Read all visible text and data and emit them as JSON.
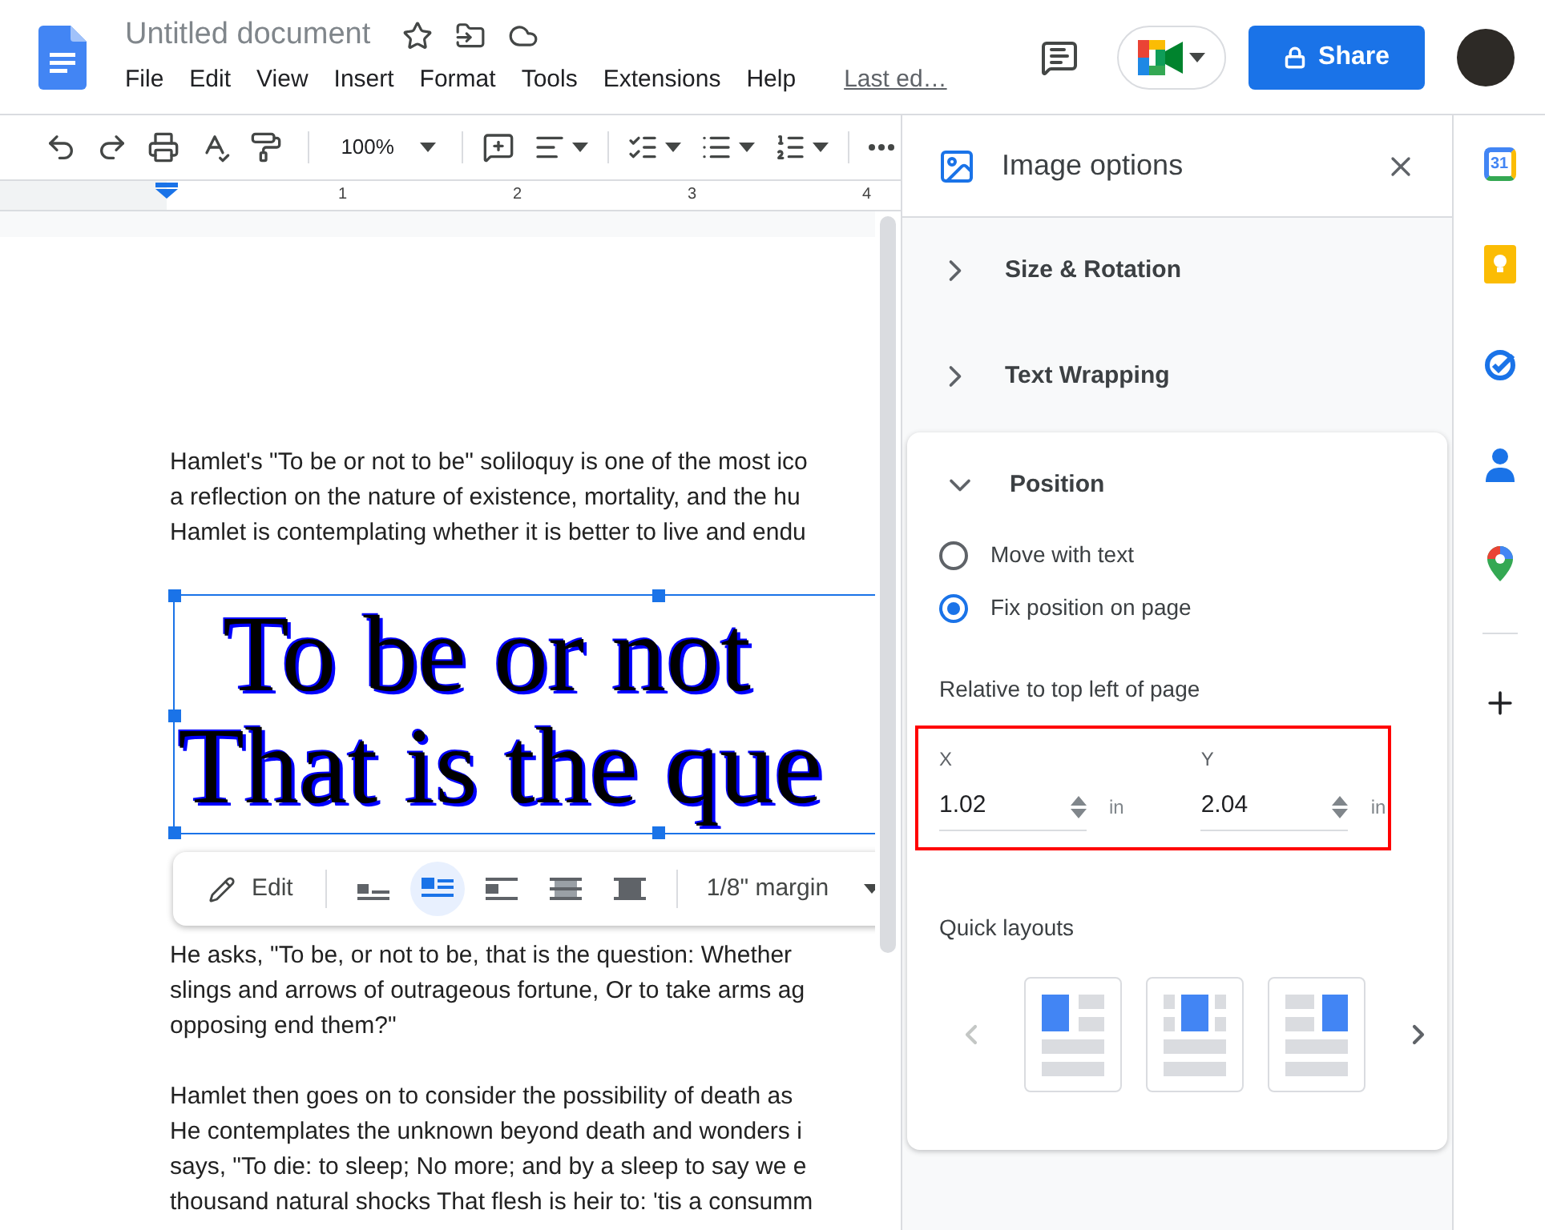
{
  "header": {
    "title": "Untitled document",
    "menus": [
      "File",
      "Edit",
      "View",
      "Insert",
      "Format",
      "Tools",
      "Extensions",
      "Help"
    ],
    "last_edit": "Last ed…",
    "share": "Share"
  },
  "toolbar": {
    "zoom": "100%"
  },
  "ruler": {
    "marks": [
      "1",
      "2",
      "3",
      "4"
    ]
  },
  "document": {
    "lines_top": [
      "Hamlet's \"To be or not to be\" soliloquy is one of the most ico",
      "a reflection on the nature of existence, mortality, and the hu",
      "Hamlet is contemplating whether it is better to live and endu"
    ],
    "image_lines": [
      "To be or not",
      "That is the que"
    ],
    "image_toolbar": {
      "edit": "Edit",
      "wrap_modes": [
        {
          "kind": "inline",
          "selected": false
        },
        {
          "kind": "wrap",
          "selected": true
        },
        {
          "kind": "break",
          "selected": false
        },
        {
          "kind": "behind",
          "selected": false
        },
        {
          "kind": "front",
          "selected": false
        }
      ],
      "margin": "1/8\" margin"
    },
    "paragraphs": [
      [
        "He asks, \"To be, or not to be, that is the question: Whether",
        "slings and arrows of outrageous fortune, Or to take arms ag",
        "opposing end them?\""
      ],
      [
        "Hamlet then goes on to consider the possibility of death as",
        "He contemplates the unknown beyond death and wonders i",
        "says, \"To die: to sleep; No more; and by a sleep to say we e",
        "thousand natural shocks That flesh is heir to: 'tis a consumm"
      ]
    ]
  },
  "panel": {
    "title": "Image options",
    "sections": [
      {
        "label": "Size & Rotation",
        "expanded": false
      },
      {
        "label": "Text Wrapping",
        "expanded": false
      },
      {
        "label": "Position",
        "expanded": true
      }
    ],
    "position": {
      "options": [
        {
          "label": "Move with text",
          "selected": false
        },
        {
          "label": "Fix position on page",
          "selected": true
        }
      ],
      "relative_label": "Relative to top left of page",
      "highlighted": true,
      "fields": [
        {
          "label": "X",
          "value": "1.02",
          "unit": "in"
        },
        {
          "label": "Y",
          "value": "2.04",
          "unit": "in"
        }
      ]
    },
    "quick_layouts": {
      "title": "Quick layouts",
      "layouts": [
        {
          "kind": "left"
        },
        {
          "kind": "center"
        },
        {
          "kind": "right"
        }
      ],
      "prev_disabled": true
    }
  },
  "rail": {
    "calendar_day": "31"
  }
}
